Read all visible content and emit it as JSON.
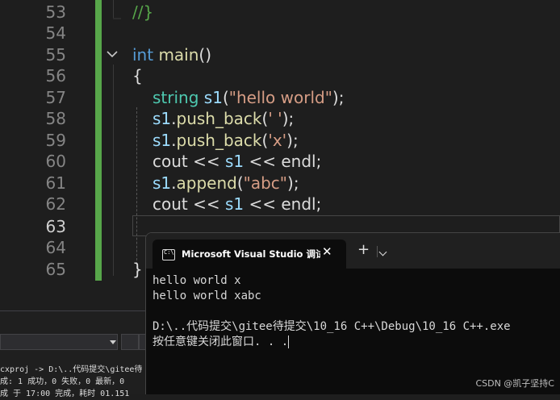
{
  "editor": {
    "line_numbers": [
      "53",
      "54",
      "55",
      "56",
      "57",
      "58",
      "59",
      "60",
      "61",
      "62",
      "63",
      "64",
      "65"
    ],
    "active_line": "63",
    "lines": {
      "l53": {
        "comment": "//}"
      },
      "l55": {
        "kw": "int",
        "fn": "main",
        "punc": "()"
      },
      "l56": {
        "punc": "{"
      },
      "l57": {
        "type": "string",
        "var": "s1",
        "p1": "(",
        "str": "\"hello world\"",
        "p2": ");"
      },
      "l58": {
        "var": "s1",
        "p1": ".",
        "fn": "push_back",
        "p2": "(",
        "str": "' '",
        "p3": ");"
      },
      "l59": {
        "var": "s1",
        "p1": ".",
        "fn": "push_back",
        "p2": "(",
        "str": "'x'",
        "p3": ");"
      },
      "l60": {
        "a": "cout << ",
        "var": "s1",
        "b": " << endl;"
      },
      "l61": {
        "var": "s1",
        "p1": ".",
        "fn": "append",
        "p2": "(",
        "str": "\"abc\"",
        "p3": ");"
      },
      "l62": {
        "a": "cout << ",
        "var": "s1",
        "b": " << endl;"
      },
      "l65": {
        "punc": "}"
      }
    }
  },
  "output_panel": {
    "lines": [
      "cxproj -> D:\\..代码提交\\gitee待",
      "成: 1 成功，0 失败，0 最新，0",
      "成 于 17:00 完成，耗时 01.151"
    ]
  },
  "console": {
    "tab_title": "Microsoft Visual Studio 调试控制台",
    "icon_text": "C:\\",
    "close_glyph": "✕",
    "new_tab_glyph": "+",
    "output": [
      "hello world x",
      "hello world xabc",
      "",
      "D:\\..代码提交\\gitee待提交\\10_16 C++\\Debug\\10_16 C++.exe",
      "按任意键关闭此窗口. . ."
    ]
  },
  "watermark": "CSDN @凯子坚持C",
  "colors": {
    "comment": "#57a64a",
    "keyword": "#569cd6",
    "function": "#dcdcaa",
    "type": "#4ec9b0",
    "variable": "#9cdcfe",
    "string": "#d69d85"
  }
}
